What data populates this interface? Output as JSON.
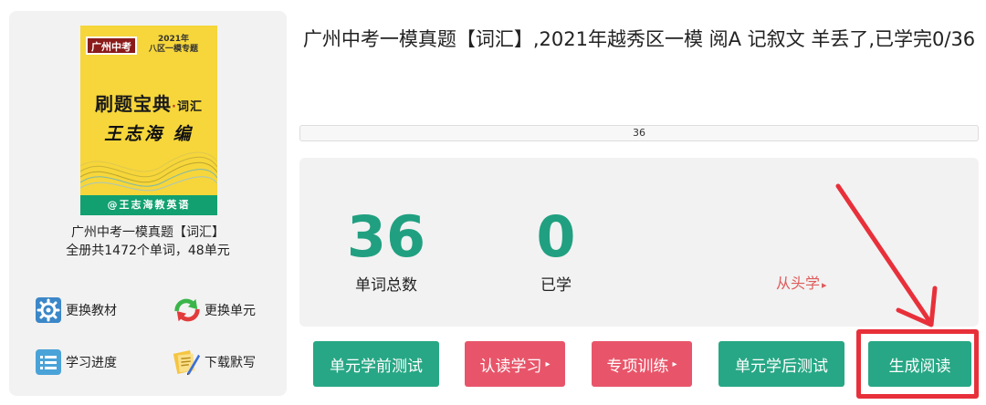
{
  "book": {
    "cover": {
      "tag": "广州中考",
      "year_line1": "2021年",
      "year_line2": "八区一模专题",
      "brand": "刷题宝典",
      "brand_sub": "词汇",
      "author": "王志海 编",
      "footer": "@王志海教英语"
    },
    "title": "广州中考一模真题【词汇】",
    "info": "全册共1472个单词，48单元"
  },
  "tools": [
    {
      "label": "更换教材",
      "icon": "gear-icon"
    },
    {
      "label": "更换单元",
      "icon": "refresh-icon"
    },
    {
      "label": "学习进度",
      "icon": "list-icon"
    },
    {
      "label": "下载默写",
      "icon": "pencil-note-icon"
    }
  ],
  "unit": {
    "title": "广州中考一模真题【词汇】,2021年越秀区一模 阅A 记叙文 羊丢了,已学完0/36",
    "progress_text": "36",
    "progress_fraction": 0
  },
  "stats": {
    "total": "36",
    "total_label": "单词总数",
    "learned": "0",
    "learned_label": "已学",
    "restart": "从头学"
  },
  "actions": [
    {
      "label": "单元学前测试",
      "style": "green"
    },
    {
      "label": "认读学习",
      "style": "red",
      "arrow": "▸"
    },
    {
      "label": "专项训练",
      "style": "red",
      "arrow": "▸"
    },
    {
      "label": "单元学后测试",
      "style": "green"
    },
    {
      "label": "生成阅读",
      "style": "green"
    }
  ],
  "colors": {
    "accent_green": "#27a785",
    "accent_red": "#e8556a",
    "stat_green": "#20a080",
    "annotation_red": "#e8303a"
  }
}
